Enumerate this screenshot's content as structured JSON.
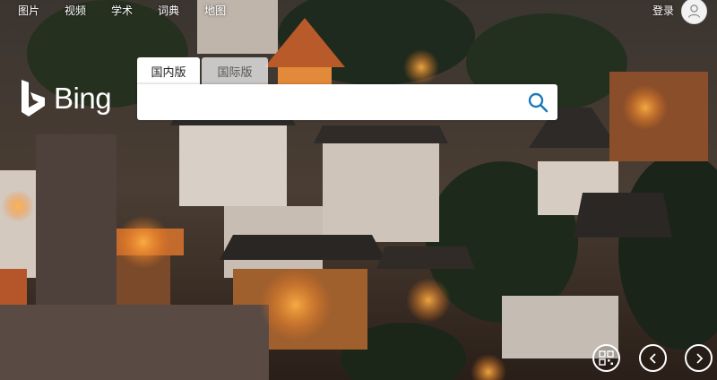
{
  "nav": {
    "items": [
      {
        "label": "图片"
      },
      {
        "label": "视频"
      },
      {
        "label": "学术"
      },
      {
        "label": "词典"
      },
      {
        "label": "地图"
      }
    ],
    "login_label": "登录"
  },
  "logo": {
    "text": "Bing",
    "icon": "bing-b-icon"
  },
  "search": {
    "tabs": [
      {
        "label": "国内版",
        "active": true
      },
      {
        "label": "国际版",
        "active": false
      }
    ],
    "value": "",
    "icon": "search-icon",
    "accent_color": "#1a7bb6"
  },
  "controls": {
    "qr_icon": "qr-code-icon",
    "prev_icon": "chevron-left-icon",
    "next_icon": "chevron-right-icon"
  }
}
